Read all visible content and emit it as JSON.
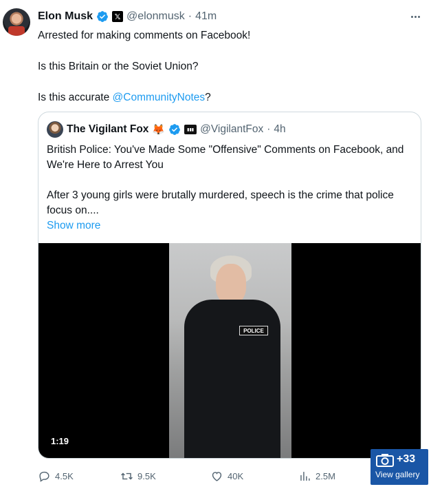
{
  "tweet": {
    "author_name": "Elon Musk",
    "handle": "@elonmusk",
    "separator": "·",
    "time": "41m",
    "lines": [
      "Arrested for making comments on Facebook!",
      "Is this Britain or the Soviet Union?"
    ],
    "question_prefix": "Is this accurate ",
    "mention": "@CommunityNotes",
    "question_suffix": "?"
  },
  "quote": {
    "author_name": "The Vigilant Fox",
    "handle": "@VigilantFox",
    "separator": "·",
    "time": "4h",
    "line1": "British Police: You've Made Some \"Offensive\" Comments on Facebook, and We're Here to Arrest You",
    "line2": "After 3 young girls were brutally murdered, speech is the crime that police focus on....",
    "show_more": "Show more",
    "video_duration": "1:19",
    "vest_text": "POLICE"
  },
  "actions": {
    "replies": "4.5K",
    "retweets": "9.5K",
    "likes": "40K",
    "views": "2.5M"
  },
  "gallery": {
    "count": "+33",
    "label": "View gallery"
  },
  "colors": {
    "link": "#1d9bf0",
    "secondary_text": "#536471",
    "gallery_bg": "#1a56a6"
  }
}
